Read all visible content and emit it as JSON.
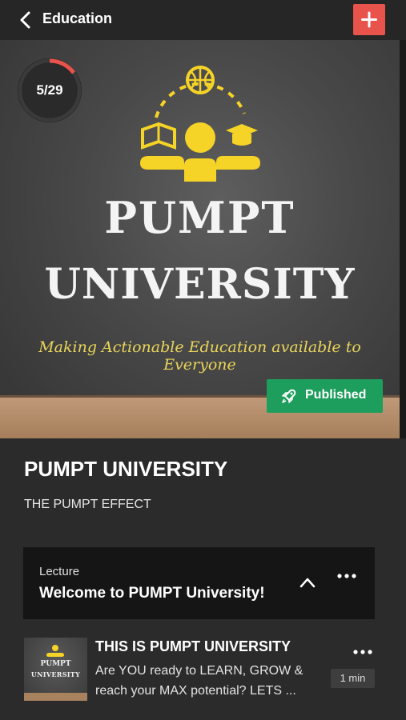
{
  "header": {
    "title": "Education",
    "back_icon": "chevron-left-icon",
    "add_icon": "plus-icon",
    "add_color": "#e8534c"
  },
  "hero": {
    "progress_label": "5/29",
    "progress_fraction": 0.172,
    "title_line1": "PUMPT",
    "title_line2": "UNIVERSITY",
    "tagline": "Making Actionable Education available to Everyone",
    "status_badge": "Published",
    "status_color": "#1e9e5c",
    "accent_color": "#f5d327"
  },
  "course": {
    "title": "PUMPT UNIVERSITY",
    "subtitle": "THE PUMPT EFFECT"
  },
  "section": {
    "type": "Lecture",
    "title": "Welcome to PUMPT University!"
  },
  "lesson": {
    "thumb_title1": "PUMPT",
    "thumb_title2": "UNIVERSITY",
    "title": "THIS IS PUMPT UNIVERSITY",
    "description": "Are YOU ready to LEARN, GROW & reach your MAX potential? LETS ...",
    "duration": "1 min"
  }
}
